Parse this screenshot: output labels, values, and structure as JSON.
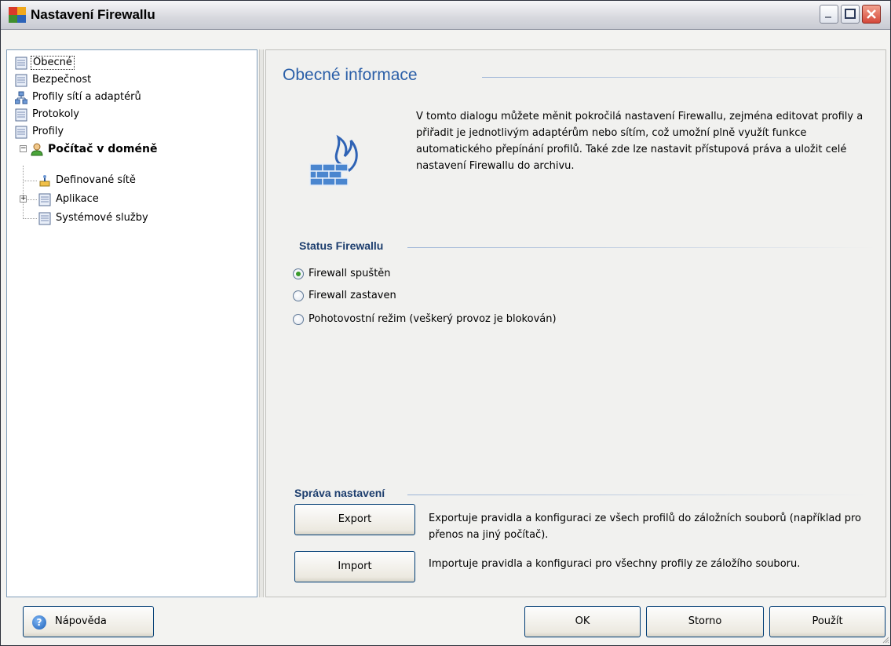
{
  "window": {
    "title": "Nastavení Firewallu"
  },
  "tree": {
    "items": [
      {
        "label": "Obecné"
      },
      {
        "label": "Bezpečnost"
      },
      {
        "label": "Profily sítí a adaptérů"
      },
      {
        "label": "Protokoly"
      },
      {
        "label": "Profily"
      },
      {
        "label": "Počítač v doméně"
      },
      {
        "label": "Definované sítě"
      },
      {
        "label": "Aplikace"
      },
      {
        "label": "Systémové služby"
      }
    ]
  },
  "main": {
    "heading": "Obecné informace",
    "intro": "V tomto dialogu můžete měnit pokročilá nastavení Firewallu, zejména editovat profily a přiřadit je jednotlivým adaptérům nebo sítím, což umožní plně využít funkce automatického přepínání profilů. Také zde lze nastavit přístupová práva a uložit celé nastavení Firewallu do archivu.",
    "status": {
      "title": "Status Firewallu",
      "options": [
        {
          "label": "Firewall spuštěn",
          "checked": true
        },
        {
          "label": "Firewall zastaven",
          "checked": false
        },
        {
          "label": "Pohotovostní režim (veškerý provoz je blokován)",
          "checked": false
        }
      ]
    },
    "management": {
      "title": "Správa nastavení",
      "export_label": "Export",
      "export_desc": "Exportuje pravidla a konfiguraci ze všech profilů do záložních souborů (například pro přenos na jiný počítač).",
      "import_label": "Import",
      "import_desc": "Importuje pravidla a konfiguraci pro všechny profily ze záložího souboru."
    }
  },
  "footer": {
    "help_label": "Nápověda",
    "ok_label": "OK",
    "cancel_label": "Storno",
    "apply_label": "Použít"
  }
}
